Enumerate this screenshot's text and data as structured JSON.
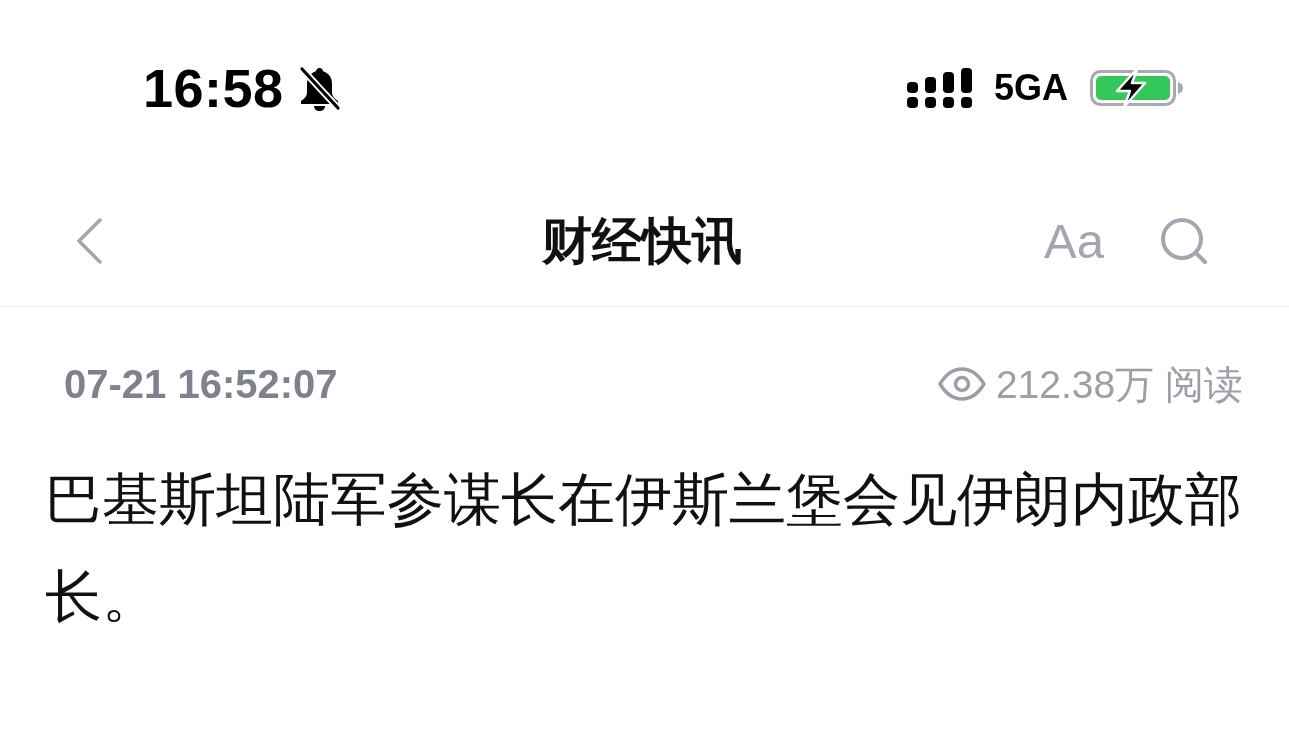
{
  "status_bar": {
    "time": "16:58",
    "silent": true,
    "network": "5GA",
    "charging": true
  },
  "nav_bar": {
    "title": "财经快讯",
    "font_button": "Aa"
  },
  "article": {
    "timestamp": "07-21 16:52:07",
    "views": "212.38万 阅读",
    "body": "巴基斯坦陆军参谋长在伊斯兰堡会见伊朗内政部长。"
  }
}
